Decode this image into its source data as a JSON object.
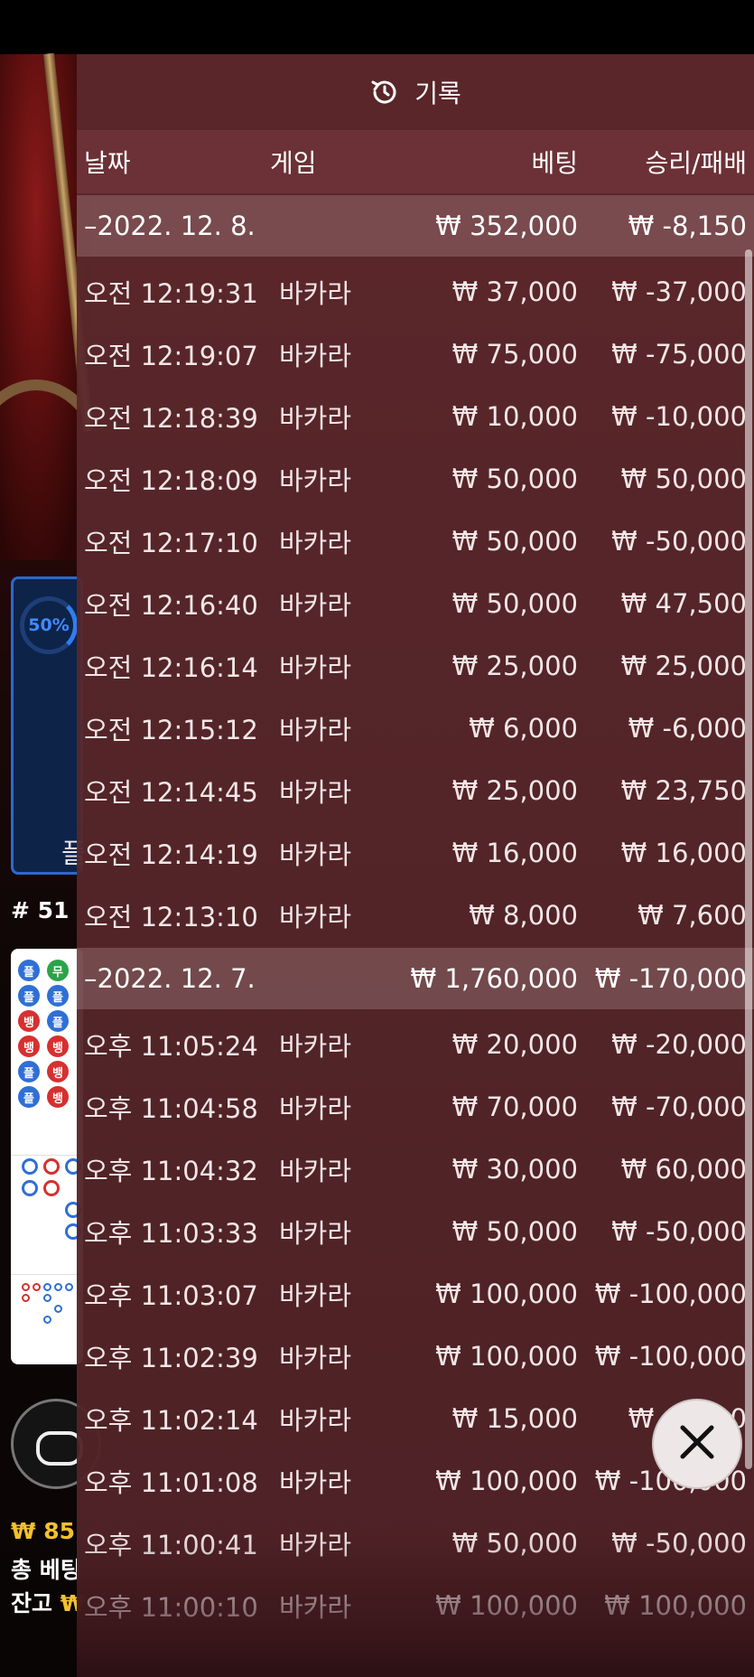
{
  "background": {
    "percent": "50%",
    "side_label": "플",
    "round": "# 51",
    "balance_line1": "₩ 85",
    "bet_line": "총 베팅",
    "balance_label": "잔고",
    "balance_symbol": "₩",
    "road_labels": [
      "플",
      "무",
      "플",
      "플",
      "뱅",
      "플",
      "뱅",
      "뱅",
      "플",
      "뱅",
      "플",
      "뱅"
    ]
  },
  "panel": {
    "title": "기록",
    "title_icon": "history-icon",
    "columns": {
      "date": "날짜",
      "game": "게임",
      "bet": "베팅",
      "result": "승리/패배"
    },
    "groups": [
      {
        "date": "–2022. 12. 8.",
        "total_bet": "₩ 352,000",
        "total_result": "₩ -8,150",
        "rows": [
          {
            "time": "오전 12:19:31",
            "game": "바카라",
            "bet": "₩ 37,000",
            "result": "₩ -37,000"
          },
          {
            "time": "오전 12:19:07",
            "game": "바카라",
            "bet": "₩ 75,000",
            "result": "₩ -75,000"
          },
          {
            "time": "오전 12:18:39",
            "game": "바카라",
            "bet": "₩ 10,000",
            "result": "₩ -10,000"
          },
          {
            "time": "오전 12:18:09",
            "game": "바카라",
            "bet": "₩ 50,000",
            "result": "₩ 50,000"
          },
          {
            "time": "오전 12:17:10",
            "game": "바카라",
            "bet": "₩ 50,000",
            "result": "₩ -50,000"
          },
          {
            "time": "오전 12:16:40",
            "game": "바카라",
            "bet": "₩ 50,000",
            "result": "₩ 47,500"
          },
          {
            "time": "오전 12:16:14",
            "game": "바카라",
            "bet": "₩ 25,000",
            "result": "₩ 25,000"
          },
          {
            "time": "오전 12:15:12",
            "game": "바카라",
            "bet": "₩ 6,000",
            "result": "₩ -6,000"
          },
          {
            "time": "오전 12:14:45",
            "game": "바카라",
            "bet": "₩ 25,000",
            "result": "₩ 23,750"
          },
          {
            "time": "오전 12:14:19",
            "game": "바카라",
            "bet": "₩ 16,000",
            "result": "₩ 16,000"
          },
          {
            "time": "오전 12:13:10",
            "game": "바카라",
            "bet": "₩ 8,000",
            "result": "₩ 7,600"
          }
        ]
      },
      {
        "date": "–2022. 12. 7.",
        "total_bet": "₩ 1,760,000",
        "total_result": "₩ -170,000",
        "rows": [
          {
            "time": "오후 11:05:24",
            "game": "바카라",
            "bet": "₩ 20,000",
            "result": "₩ -20,000"
          },
          {
            "time": "오후 11:04:58",
            "game": "바카라",
            "bet": "₩ 70,000",
            "result": "₩ -70,000"
          },
          {
            "time": "오후 11:04:32",
            "game": "바카라",
            "bet": "₩ 30,000",
            "result": "₩ 60,000"
          },
          {
            "time": "오후 11:03:33",
            "game": "바카라",
            "bet": "₩ 50,000",
            "result": "₩ -50,000"
          },
          {
            "time": "오후 11:03:07",
            "game": "바카라",
            "bet": "₩ 100,000",
            "result": "₩ -100,000"
          },
          {
            "time": "오후 11:02:39",
            "game": "바카라",
            "bet": "₩ 100,000",
            "result": "₩ -100,000"
          },
          {
            "time": "오후 11:02:14",
            "game": "바카라",
            "bet": "₩ 15,000",
            "result": "₩ -5,000"
          },
          {
            "time": "오후 11:01:08",
            "game": "바카라",
            "bet": "₩ 100,000",
            "result": "₩ -100,000"
          },
          {
            "time": "오후 11:00:41",
            "game": "바카라",
            "bet": "₩ 50,000",
            "result": "₩ -50,000"
          },
          {
            "time": "오후 11:00:10",
            "game": "바카라",
            "bet": "₩ 100,000",
            "result": "₩ 100,000"
          }
        ]
      }
    ],
    "close_icon": "close-icon"
  },
  "colors": {
    "panel_bg": "#5c282c",
    "group_bg": "#8a6466",
    "accent_gold": "#f2c12e",
    "road_blue": "#2f6fd6",
    "road_red": "#d6302f"
  }
}
